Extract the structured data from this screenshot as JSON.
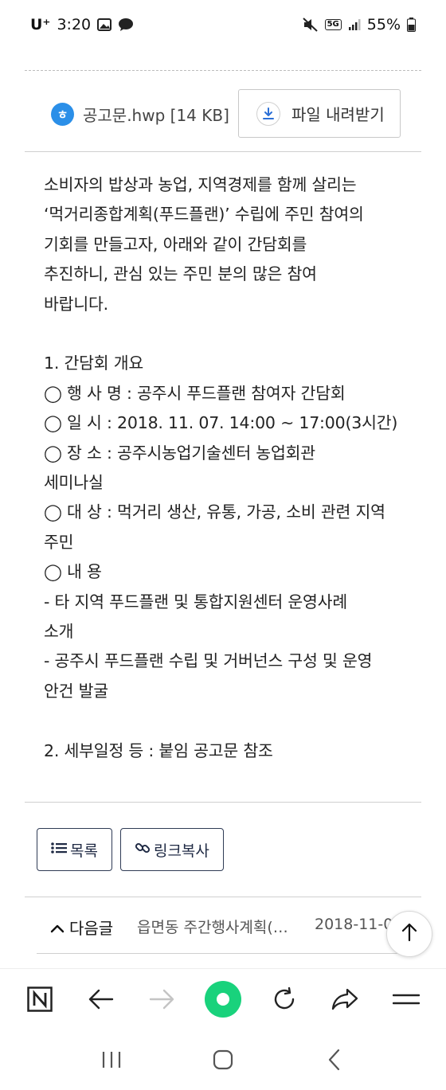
{
  "status_bar": {
    "carrier": "U⁺",
    "time": "3:20",
    "network": "5G",
    "battery": "55%"
  },
  "attachment": {
    "file_icon": "hwp-file-icon",
    "file_name": "공고문.hwp [14 KB]",
    "download_label": "파일 내려받기"
  },
  "content": {
    "lines": [
      "소비자의 밥상과 농업, 지역경제를 함께 살리는",
      "‘먹거리종합계획(푸드플랜)’ 수립에 주민 참여의",
      "기회를 만들고자, 아래와 같이 간담회를",
      "추진하니, 관심 있는 주민 분의 많은 참여",
      "바랍니다.",
      "",
      "1. 간담회 개요",
      "◯ 행 사 명 : 공주시 푸드플랜 참여자 간담회",
      "◯ 일 시 : 2018. 11. 07. 14:00 ~ 17:00(3시간)",
      "◯ 장 소 : 공주시농업기술센터 농업회관",
      "세미나실",
      "◯ 대 상 : 먹거리 생산, 유통, 가공, 소비 관련 지역",
      "주민",
      "◯ 내 용",
      "- 타 지역 푸드플랜 및 통합지원센터 운영사례",
      "소개",
      "- 공주시 푸드플랜 수립 및 거버넌스 구성 및 운영",
      "안건 발굴",
      "",
      "2. 세부일정 등 : 붙임 공고문 참조"
    ]
  },
  "actions": {
    "list_label": "목록",
    "copy_link_label": "링크복사"
  },
  "next_post": {
    "label": "다음글",
    "title": "읍면동 주간행사계획(…",
    "date": "2018-11-0"
  },
  "colors": {
    "accent_green": "#19d27c",
    "button_border": "#2f3b55",
    "file_icon_blue": "#2b8fe8"
  },
  "icons": {
    "toolbar": [
      "naver-n-icon",
      "back-arrow-icon",
      "forward-arrow-icon",
      "home-green-dot-icon",
      "refresh-icon",
      "share-icon",
      "menu-icon"
    ],
    "navbar": [
      "recent-apps-icon",
      "home-icon",
      "back-icon"
    ]
  }
}
